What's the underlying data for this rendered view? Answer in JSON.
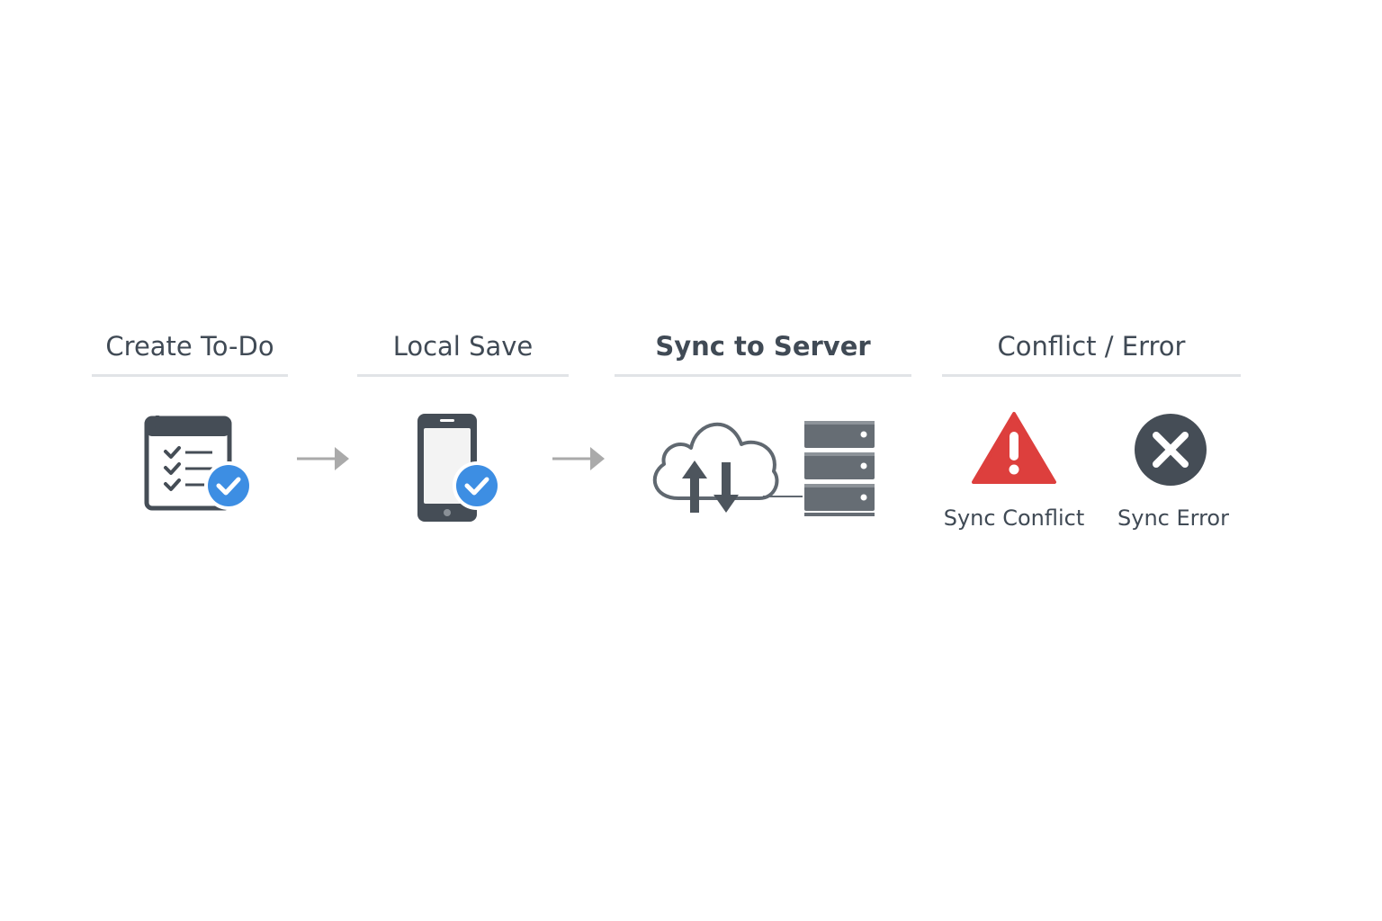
{
  "stages": [
    {
      "title": "Create To-Do",
      "icon": "checklist-check-icon"
    },
    {
      "title": "Local Save",
      "icon": "phone-check-icon"
    },
    {
      "title": "Sync to Server",
      "icon": "cloud-sync-server-icon"
    },
    {
      "title": "Conflict / Error",
      "icon": "conflict-error-icon"
    }
  ],
  "outcomes": {
    "conflict": {
      "label": "Sync Conflict",
      "icon": "warning-triangle-icon"
    },
    "error": {
      "label": "Sync Error",
      "icon": "x-circle-icon"
    }
  },
  "colors": {
    "text": "#404a55",
    "icon_dark": "#454d56",
    "accent_blue": "#3d8ee3",
    "warning_red": "#dd3f3d",
    "rule": "#e1e4e7",
    "arrow": "#aaaaaa"
  }
}
